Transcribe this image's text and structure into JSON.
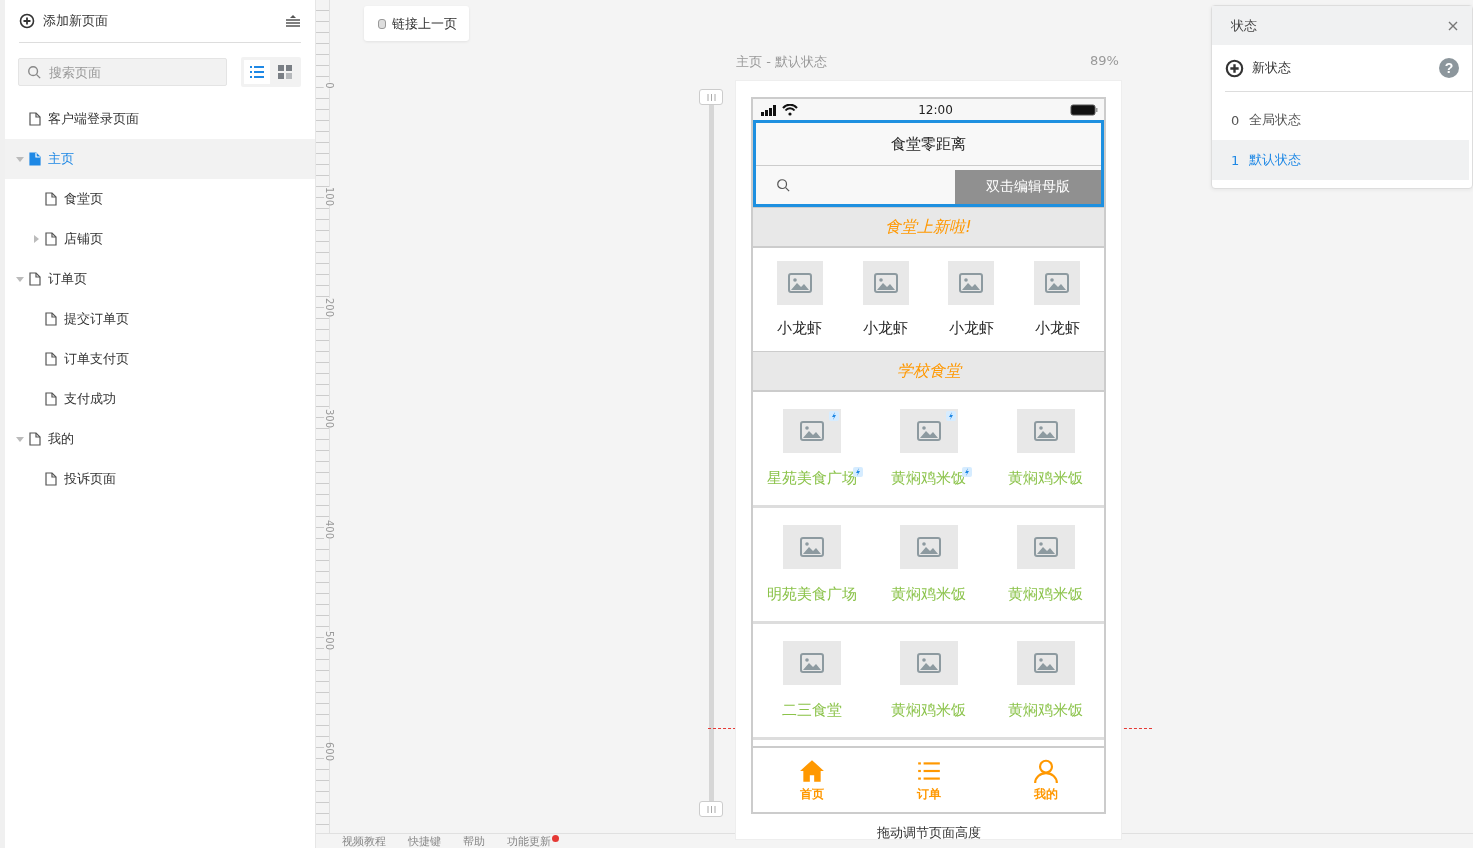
{
  "sidebar": {
    "add_page": "添加新页面",
    "search": {
      "placeholder": "搜索页面"
    },
    "view_modes": [
      {
        "kind": "list",
        "selected": true
      },
      {
        "kind": "grid",
        "selected": false
      }
    ],
    "pages": [
      {
        "label": "客户端登录页面",
        "selected": false
      },
      {
        "label": "主页",
        "selected": true,
        "expanded": true,
        "children": [
          {
            "label": "食堂页",
            "selected": false
          },
          {
            "label": "店铺页",
            "selected": false,
            "expanded": false
          }
        ]
      },
      {
        "label": "订单页",
        "selected": false,
        "expanded": true,
        "children": [
          {
            "label": "提交订单页",
            "selected": false
          },
          {
            "label": "订单支付页",
            "selected": false
          },
          {
            "label": "支付成功",
            "selected": false
          }
        ]
      },
      {
        "label": "我的",
        "selected": false,
        "expanded": true,
        "children": [
          {
            "label": "投诉页面",
            "selected": false
          }
        ]
      }
    ]
  },
  "canvas": {
    "ruler_labels": [
      "0",
      "100",
      "200",
      "300",
      "400",
      "500",
      "600"
    ],
    "link_chip": "链接上一页",
    "page_label": "主页 - 默认状态",
    "zoom": "89%",
    "resize_hint": "拖动调节页面高度"
  },
  "phone": {
    "time": "12:00",
    "title": "食堂零距离",
    "master_button": "双击编辑母版",
    "new_section": "食堂上新啦!",
    "new_items": [
      "小龙虾",
      "小龙虾",
      "小龙虾",
      "小龙虾"
    ],
    "canteen_section": "学校食堂",
    "canteen_rows": [
      [
        {
          "name": "星苑美食广场",
          "flagged": true
        },
        {
          "name": "黄焖鸡米饭",
          "flagged": true
        },
        {
          "name": "黄焖鸡米饭",
          "flagged": false
        }
      ],
      [
        {
          "name": "明苑美食广场",
          "flagged": false
        },
        {
          "name": "黄焖鸡米饭",
          "flagged": false
        },
        {
          "name": "黄焖鸡米饭",
          "flagged": false
        }
      ],
      [
        {
          "name": "二三食堂",
          "flagged": false
        },
        {
          "name": "黄焖鸡米饭",
          "flagged": false
        },
        {
          "name": "黄焖鸡米饭",
          "flagged": false
        }
      ]
    ],
    "tabs": [
      {
        "label": "首页",
        "kind": "home"
      },
      {
        "label": "订单",
        "kind": "list"
      },
      {
        "label": "我的",
        "kind": "user"
      }
    ]
  },
  "states_panel": {
    "title": "状态",
    "new_state": "新状态",
    "help": "?",
    "states": [
      {
        "index": "0",
        "name": "全局状态",
        "selected": false
      },
      {
        "index": "1",
        "name": "默认状态",
        "selected": true
      }
    ]
  },
  "footer": [
    {
      "label": "视频教程",
      "badge": false
    },
    {
      "label": "快捷键",
      "badge": false
    },
    {
      "label": "帮助",
      "badge": false
    },
    {
      "label": "功能更新",
      "badge": true
    }
  ]
}
